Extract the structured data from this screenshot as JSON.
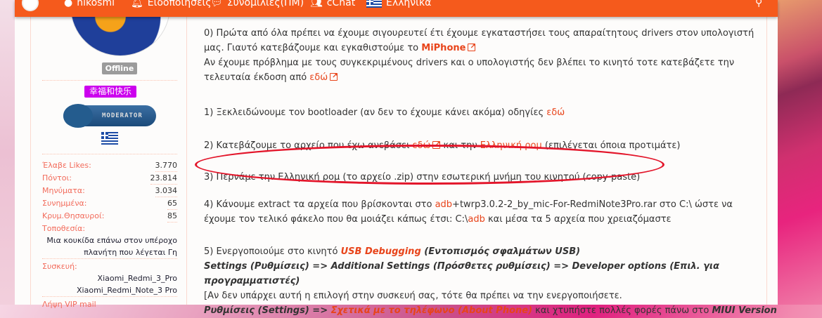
{
  "header": {
    "user": "nikosmi",
    "notifications": "Ειδοποιήσεις",
    "conversations": "Συνομιλίες(ΠΜ)",
    "chat": "cChat",
    "language": "Ελληνικά"
  },
  "sidebar": {
    "status": "Offline",
    "usertitle": "幸福和快乐",
    "badge": "MODERATOR",
    "stats": [
      {
        "label": "Έλαβε Likes:",
        "value": "3.770"
      },
      {
        "label": "Πόντοι:",
        "value": "23.814"
      },
      {
        "label": "Μηνύματα:",
        "value": "3.034"
      },
      {
        "label": "Συνημμένα:",
        "value": "65"
      },
      {
        "label": "Κρυμ.Θησαυροί:",
        "value": "85"
      }
    ],
    "location_label": "Τοποθεσία:",
    "location_1": "Μια κουκίδα επάνω στον υπέροχο",
    "location_2": "πλανήτη που λέγεται Γη",
    "device_label": "Συσκευή:",
    "device_1": "Xiaomi_Redmi_3_Pro",
    "device_2": "Xiaomi_Redmi_Note_3 Pro",
    "vip_label": "Λήψη VIP mail"
  },
  "post": {
    "s0a": "0) Πρώτα από όλα πρέπει να έχουμε σιγουρευτεί έτι έχουμε εγκαταστήσει τους απαραίτητους drivers στον υπολογιστή",
    "s0b": "μας. Γιαυτό κατεβάζουμε και εγκαθιστούμε το ",
    "miphone": "MiPhone",
    "s0c": "Αν έχουμε πρόβλημα με τους συγκεκριμένους drivers και ο υπολογιστής δεν βλέπει το κινητό τοτε κατεβάζετε την",
    "s0d": "τελευταία έκδοση από ",
    "edo": "εδώ",
    "s1": "1) Ξεκλειδώνουμε τον bootloader (αν δεν το έχουμε κάνει ακόμα) οδηγίες ",
    "s2a": "2) Κατεβάζουμε το αρχείο που έχω ανεβάσει ",
    "s2b": " και την ",
    "rom": "Ελληνική ρομ",
    "s2c": " (επιλέγεται όποια προτιμάτε)",
    "s3": "3) Περνάμε την Ελληνική ρομ (το αρχείο .zip) στην εσωτερική μνήμη του κινητού (copy-paste)",
    "s4a": "4) Κάνουμε extract τα αρχεία που βρίσκονται στο ",
    "adb": "adb",
    "s4b": "+twrp3.0.2-2_by_mic-For-RedmiNote3Pro.rar στο C:\\ ώστε να",
    "s4c": "έχουμε τον τελικό φάκελο που θα μοιάζει κάπως έτσι: C:\\",
    "s4d": " και μέσα τα 5 αρχεία που χρειαζόμαστε",
    "s5a": "5) Ενεργοποιούμε στο κινητό ",
    "usb": "USB Debugging",
    "s5b": " (Εντοπισμός σφαλμάτων USB)",
    "s5c": "Settings (Ρυθμίσεις) => Additional Settings (Πρόσθετες ρυθμίσεις) => Developer options (Επιλ. για",
    "s5d": "προγραμματιστές)",
    "s5e": "[Αν δεν υπάρχει αυτή η επιλογή στην συσκευή σας, τότε θα πρέπει να την ενεργοποιήσετε.",
    "s5f": "Ρυθμίσεις (Settings) => ",
    "about": "Σχετικά με το τηλέφωνο (About Phone)",
    "s5g": " και χτυπήστε πολλές φορές πάνω στο ",
    "miui": "MIUI Version"
  }
}
